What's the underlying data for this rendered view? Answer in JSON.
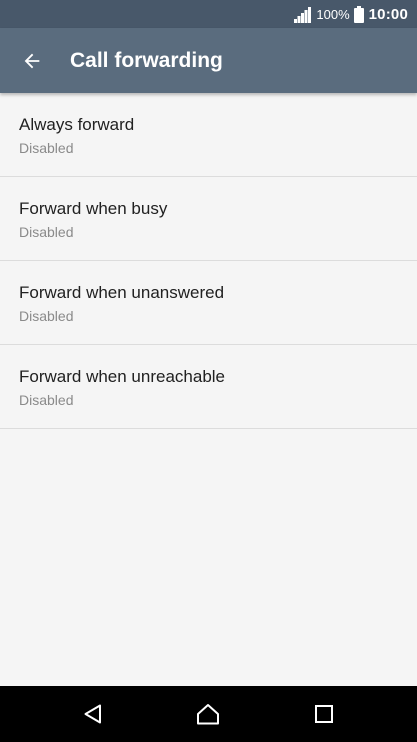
{
  "status_bar": {
    "battery_percent": "100%",
    "time": "10:00",
    "icons": [
      "signal-icon",
      "battery-icon"
    ]
  },
  "app_bar": {
    "title": "Call forwarding",
    "back_icon": "arrow-left-icon"
  },
  "list": {
    "items": [
      {
        "title": "Always forward",
        "subtitle": "Disabled"
      },
      {
        "title": "Forward when busy",
        "subtitle": "Disabled"
      },
      {
        "title": "Forward when unanswered",
        "subtitle": "Disabled"
      },
      {
        "title": "Forward when unreachable",
        "subtitle": "Disabled"
      }
    ]
  },
  "nav_bar": {
    "icons": [
      "triangle-back-icon",
      "home-icon",
      "square-recents-icon"
    ]
  },
  "colors": {
    "status_bar": "#48586a",
    "app_bar": "#5a6c7e",
    "background": "#f5f5f5",
    "nav_bar": "#000000",
    "primary_text": "#212121",
    "secondary_text": "#8a8a8a"
  }
}
